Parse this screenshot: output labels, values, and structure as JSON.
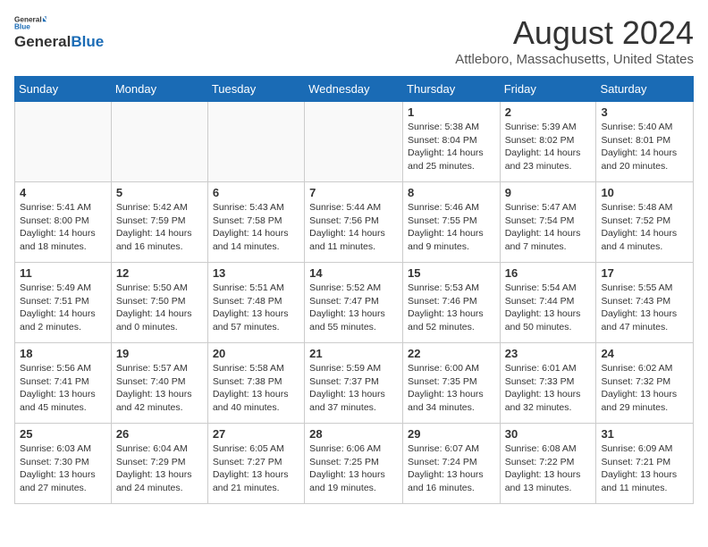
{
  "header": {
    "logo_general": "General",
    "logo_blue": "Blue",
    "title": "August 2024",
    "location": "Attleboro, Massachusetts, United States"
  },
  "days_of_week": [
    "Sunday",
    "Monday",
    "Tuesday",
    "Wednesday",
    "Thursday",
    "Friday",
    "Saturday"
  ],
  "weeks": [
    [
      {
        "day": "",
        "empty": true
      },
      {
        "day": "",
        "empty": true
      },
      {
        "day": "",
        "empty": true
      },
      {
        "day": "",
        "empty": true
      },
      {
        "day": "1",
        "sunrise": "5:38 AM",
        "sunset": "8:04 PM",
        "daylight": "14 hours and 25 minutes."
      },
      {
        "day": "2",
        "sunrise": "5:39 AM",
        "sunset": "8:02 PM",
        "daylight": "14 hours and 23 minutes."
      },
      {
        "day": "3",
        "sunrise": "5:40 AM",
        "sunset": "8:01 PM",
        "daylight": "14 hours and 20 minutes."
      }
    ],
    [
      {
        "day": "4",
        "sunrise": "5:41 AM",
        "sunset": "8:00 PM",
        "daylight": "14 hours and 18 minutes."
      },
      {
        "day": "5",
        "sunrise": "5:42 AM",
        "sunset": "7:59 PM",
        "daylight": "14 hours and 16 minutes."
      },
      {
        "day": "6",
        "sunrise": "5:43 AM",
        "sunset": "7:58 PM",
        "daylight": "14 hours and 14 minutes."
      },
      {
        "day": "7",
        "sunrise": "5:44 AM",
        "sunset": "7:56 PM",
        "daylight": "14 hours and 11 minutes."
      },
      {
        "day": "8",
        "sunrise": "5:46 AM",
        "sunset": "7:55 PM",
        "daylight": "14 hours and 9 minutes."
      },
      {
        "day": "9",
        "sunrise": "5:47 AM",
        "sunset": "7:54 PM",
        "daylight": "14 hours and 7 minutes."
      },
      {
        "day": "10",
        "sunrise": "5:48 AM",
        "sunset": "7:52 PM",
        "daylight": "14 hours and 4 minutes."
      }
    ],
    [
      {
        "day": "11",
        "sunrise": "5:49 AM",
        "sunset": "7:51 PM",
        "daylight": "14 hours and 2 minutes."
      },
      {
        "day": "12",
        "sunrise": "5:50 AM",
        "sunset": "7:50 PM",
        "daylight": "14 hours and 0 minutes."
      },
      {
        "day": "13",
        "sunrise": "5:51 AM",
        "sunset": "7:48 PM",
        "daylight": "13 hours and 57 minutes."
      },
      {
        "day": "14",
        "sunrise": "5:52 AM",
        "sunset": "7:47 PM",
        "daylight": "13 hours and 55 minutes."
      },
      {
        "day": "15",
        "sunrise": "5:53 AM",
        "sunset": "7:46 PM",
        "daylight": "13 hours and 52 minutes."
      },
      {
        "day": "16",
        "sunrise": "5:54 AM",
        "sunset": "7:44 PM",
        "daylight": "13 hours and 50 minutes."
      },
      {
        "day": "17",
        "sunrise": "5:55 AM",
        "sunset": "7:43 PM",
        "daylight": "13 hours and 47 minutes."
      }
    ],
    [
      {
        "day": "18",
        "sunrise": "5:56 AM",
        "sunset": "7:41 PM",
        "daylight": "13 hours and 45 minutes."
      },
      {
        "day": "19",
        "sunrise": "5:57 AM",
        "sunset": "7:40 PM",
        "daylight": "13 hours and 42 minutes."
      },
      {
        "day": "20",
        "sunrise": "5:58 AM",
        "sunset": "7:38 PM",
        "daylight": "13 hours and 40 minutes."
      },
      {
        "day": "21",
        "sunrise": "5:59 AM",
        "sunset": "7:37 PM",
        "daylight": "13 hours and 37 minutes."
      },
      {
        "day": "22",
        "sunrise": "6:00 AM",
        "sunset": "7:35 PM",
        "daylight": "13 hours and 34 minutes."
      },
      {
        "day": "23",
        "sunrise": "6:01 AM",
        "sunset": "7:33 PM",
        "daylight": "13 hours and 32 minutes."
      },
      {
        "day": "24",
        "sunrise": "6:02 AM",
        "sunset": "7:32 PM",
        "daylight": "13 hours and 29 minutes."
      }
    ],
    [
      {
        "day": "25",
        "sunrise": "6:03 AM",
        "sunset": "7:30 PM",
        "daylight": "13 hours and 27 minutes."
      },
      {
        "day": "26",
        "sunrise": "6:04 AM",
        "sunset": "7:29 PM",
        "daylight": "13 hours and 24 minutes."
      },
      {
        "day": "27",
        "sunrise": "6:05 AM",
        "sunset": "7:27 PM",
        "daylight": "13 hours and 21 minutes."
      },
      {
        "day": "28",
        "sunrise": "6:06 AM",
        "sunset": "7:25 PM",
        "daylight": "13 hours and 19 minutes."
      },
      {
        "day": "29",
        "sunrise": "6:07 AM",
        "sunset": "7:24 PM",
        "daylight": "13 hours and 16 minutes."
      },
      {
        "day": "30",
        "sunrise": "6:08 AM",
        "sunset": "7:22 PM",
        "daylight": "13 hours and 13 minutes."
      },
      {
        "day": "31",
        "sunrise": "6:09 AM",
        "sunset": "7:21 PM",
        "daylight": "13 hours and 11 minutes."
      }
    ]
  ]
}
